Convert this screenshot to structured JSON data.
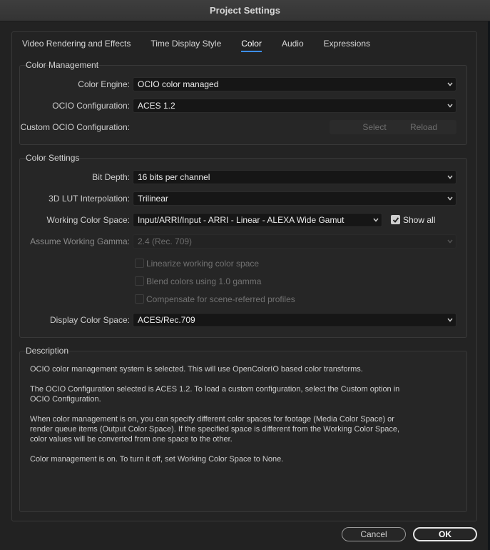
{
  "window": {
    "title": "Project Settings"
  },
  "tabs": [
    {
      "label": "Video Rendering and Effects"
    },
    {
      "label": "Time Display Style"
    },
    {
      "label": "Color"
    },
    {
      "label": "Audio"
    },
    {
      "label": "Expressions"
    }
  ],
  "color_management": {
    "title": "Color Management",
    "engine": {
      "label": "Color Engine:",
      "value": "OCIO color managed"
    },
    "ocio_config": {
      "label": "OCIO Configuration:",
      "value": "ACES 1.2"
    },
    "custom_ocio": {
      "label": "Custom OCIO Configuration:",
      "select_label": "Select",
      "reload_label": "Reload"
    }
  },
  "color_settings": {
    "title": "Color Settings",
    "bit_depth": {
      "label": "Bit Depth:",
      "value": "16 bits per channel"
    },
    "lut_interp": {
      "label": "3D LUT Interpolation:",
      "value": "Trilinear"
    },
    "working_space": {
      "label": "Working Color Space:",
      "value": "Input/ARRI/Input - ARRI - Linear - ALEXA Wide Gamut",
      "show_all_label": "Show all",
      "show_all_checked": true
    },
    "gamma": {
      "label": "Assume Working Gamma:",
      "value": "2.4 (Rec. 709)"
    },
    "checkboxes": [
      {
        "label": "Linearize working color space",
        "checked": false
      },
      {
        "label": "Blend colors using 1.0 gamma",
        "checked": false
      },
      {
        "label": "Compensate for scene-referred profiles",
        "checked": false
      }
    ],
    "display_space": {
      "label": "Display Color Space:",
      "value": "ACES/Rec.709"
    }
  },
  "description": {
    "title": "Description",
    "paragraphs": [
      "OCIO color management system is selected. This will use OpenColorIO based color transforms.",
      "The OCIO Configuration selected is ACES 1.2. To load a custom configuration, select the Custom option in OCIO Configuration.",
      "When color management is on, you can specify different color spaces for footage (Media Color Space) or render queue items (Output Color Space). If the specified space is different from the Working Color Space, color values will be converted from one space to the other.",
      "Color management is on. To turn it off, set Working Color Space to None."
    ]
  },
  "footer": {
    "cancel_label": "Cancel",
    "ok_label": "OK"
  },
  "colors": {
    "accent": "#3d8ee8",
    "background": "#222222",
    "field": "#161616"
  }
}
